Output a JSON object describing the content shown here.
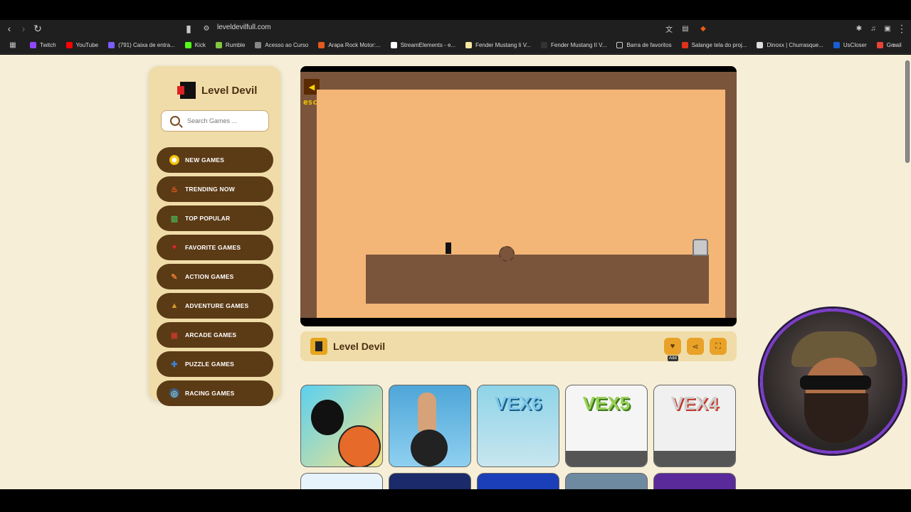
{
  "browser": {
    "url": "leveldevilfull.com",
    "bookmarks": [
      {
        "label": "Twitch",
        "color": "#9146ff"
      },
      {
        "label": "YouTube",
        "color": "#ff0000"
      },
      {
        "label": "(791) Caixa de entra...",
        "color": "#7c5cff"
      },
      {
        "label": "Kick",
        "color": "#53fc18"
      },
      {
        "label": "Rumble",
        "color": "#85c742"
      },
      {
        "label": "Acesso ao Curso",
        "color": "#888888"
      },
      {
        "label": "Arapa Rock Motor:...",
        "color": "#e25a1c"
      },
      {
        "label": "StreamElements - e...",
        "color": "#ffffff"
      },
      {
        "label": "Fender Mustang Ii V...",
        "color": "#f5e6a0"
      },
      {
        "label": "Fender Mustang II V...",
        "color": "#333333"
      },
      {
        "label": "Barra de favoritos",
        "color": "#cccccc"
      },
      {
        "label": "Salange tela do proj...",
        "color": "#e0311a"
      },
      {
        "label": "Dinoxx | Churrasque...",
        "color": "#dddddd"
      },
      {
        "label": "UsCloser",
        "color": "#1a5ed6"
      },
      {
        "label": "Gmail",
        "color": "#ea4335"
      }
    ]
  },
  "sidebar": {
    "logo_text": "Level Devil",
    "search_placeholder": "Search Games ...",
    "items": [
      {
        "label": "NEW GAMES",
        "icon": "new-icon",
        "color": "#f2c200"
      },
      {
        "label": "TRENDING NOW",
        "icon": "fire-icon",
        "color": "#f05a1a"
      },
      {
        "label": "TOP POPULAR",
        "icon": "chart-icon",
        "color": "#4caf50"
      },
      {
        "label": "FAVORITE GAMES",
        "icon": "heart-icon",
        "color": "#d9262c"
      },
      {
        "label": "ACTION GAMES",
        "icon": "action-icon",
        "color": "#e07a2f"
      },
      {
        "label": "ADVENTURE GAMES",
        "icon": "adventure-icon",
        "color": "#d99a2b"
      },
      {
        "label": "ARCADE GAMES",
        "icon": "arcade-icon",
        "color": "#c0392b"
      },
      {
        "label": "PUZZLE GAMES",
        "icon": "puzzle-icon",
        "color": "#3a86d8"
      },
      {
        "label": "RACING GAMES",
        "icon": "racing-icon",
        "color": "#3f5c7a"
      }
    ]
  },
  "game": {
    "esc_label": "esc",
    "title": "Level Devil",
    "add_tooltip": "Add"
  },
  "thumbnails": [
    {
      "label": "",
      "bg": "#5ad0f0"
    },
    {
      "label": "",
      "bg": "#4ea6d8"
    },
    {
      "label": "VEX6",
      "bg": "#8fd4e8"
    },
    {
      "label": "VEX5",
      "bg": "#f5f5f5"
    },
    {
      "label": "VEX4",
      "bg": "#f0f0f0"
    }
  ],
  "thumbnails_row2": [
    {
      "bg": "#e6f3fb"
    },
    {
      "bg": "#1a2a6a"
    },
    {
      "bg": "#1b3fb8"
    },
    {
      "bg": "#6e8aa0"
    },
    {
      "bg": "#5b2a9a"
    }
  ]
}
